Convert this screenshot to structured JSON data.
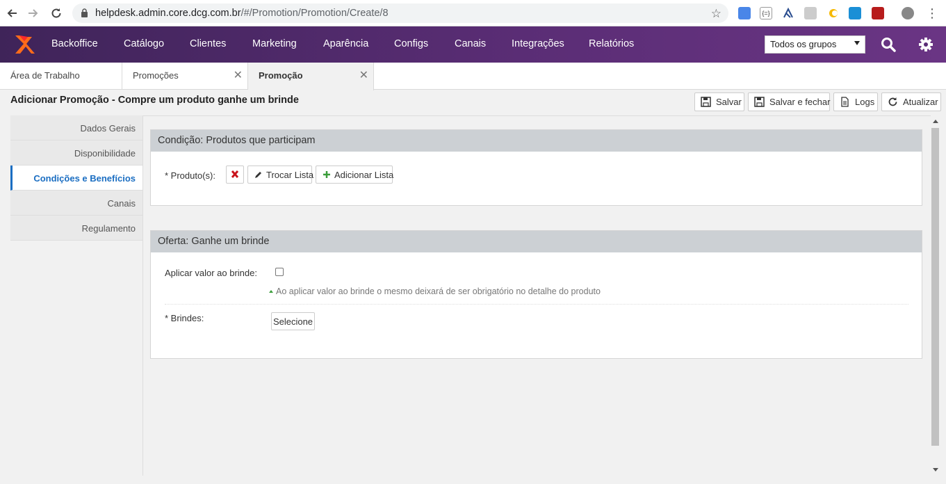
{
  "browser": {
    "url_host": "helpdesk.admin.core.dcg.com.br",
    "url_path": "/#/Promotion/Promotion/Create/8"
  },
  "topnav": {
    "menu": [
      "Backoffice",
      "Catálogo",
      "Clientes",
      "Marketing",
      "Aparência",
      "Configs",
      "Canais",
      "Integrações",
      "Relatórios"
    ],
    "group_select": "Todos os grupos"
  },
  "tabs": [
    {
      "label": "Área de Trabalho"
    },
    {
      "label": "Promoções"
    },
    {
      "label": "Promoção"
    }
  ],
  "page": {
    "title": "Adicionar Promoção - Compre um produto ganhe um brinde",
    "actions": {
      "save": "Salvar",
      "save_close": "Salvar e fechar",
      "logs": "Logs",
      "refresh": "Atualizar"
    }
  },
  "sidebar": {
    "items": [
      "Dados Gerais",
      "Disponibilidade",
      "Condições e Benefícios",
      "Canais",
      "Regulamento"
    ]
  },
  "condition_panel": {
    "title": "Condição: Produtos que participam",
    "products_label": "* Produto(s):",
    "change_list": "Trocar Lista",
    "add_list": "Adicionar Lista"
  },
  "offer_panel": {
    "title": "Oferta: Ganhe um brinde",
    "apply_value_label": "Aplicar valor ao brinde:",
    "apply_value_hint": "Ao aplicar valor ao brinde o mesmo deixará de ser obrigatório no detalhe do produto",
    "gifts_label": "* Brindes:",
    "select_button": "Selecione"
  },
  "colors": {
    "nav_gradient_start": "#3f2459",
    "nav_gradient_end": "#6a3584",
    "active_link": "#1b6ec2",
    "panel_header": "#ccd0d4"
  }
}
